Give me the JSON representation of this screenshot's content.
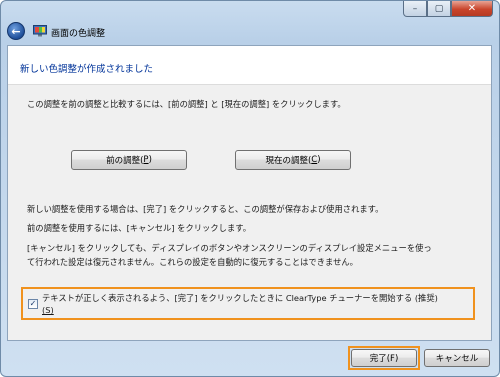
{
  "window": {
    "title": "画面の色調整",
    "buttons": {
      "minimize": "–",
      "maximize": "▢",
      "close": "✕"
    }
  },
  "header": {
    "text": "新しい色調整が作成されました"
  },
  "body": {
    "compare_text": "この調整を前の調整と比較するには、[前の調整] と [現在の調整] をクリックします。",
    "prev_button": {
      "label": "前の調整(",
      "key": "P",
      "suffix": ")"
    },
    "current_button": {
      "label": "現在の調整(",
      "key": "C",
      "suffix": ")"
    },
    "line1": "新しい調整を使用する場合は、[完了] をクリックすると、この調整が保存および使用されます。",
    "line2": "前の調整を使用するには、[キャンセル] をクリックします。",
    "line3a": "[キャンセル] をクリックしても、ディスプレイのボタンやオンスクリーンのディスプレイ設定メニューを使っ",
    "line3b": "て行われた設定は復元されません。これらの設定を自動的に復元することはできません。"
  },
  "checkbox": {
    "checked": true,
    "label_line1": "テキストが正しく表示されるよう、[完了] をクリックしたときに ClearType チューナーを開始する (推奨)",
    "label_line2": "(S)"
  },
  "footer": {
    "finish_button": "完了(F)",
    "cancel_button": "キャンセル"
  },
  "colors": {
    "header_text": "#003399",
    "highlight": "#f0921e"
  }
}
